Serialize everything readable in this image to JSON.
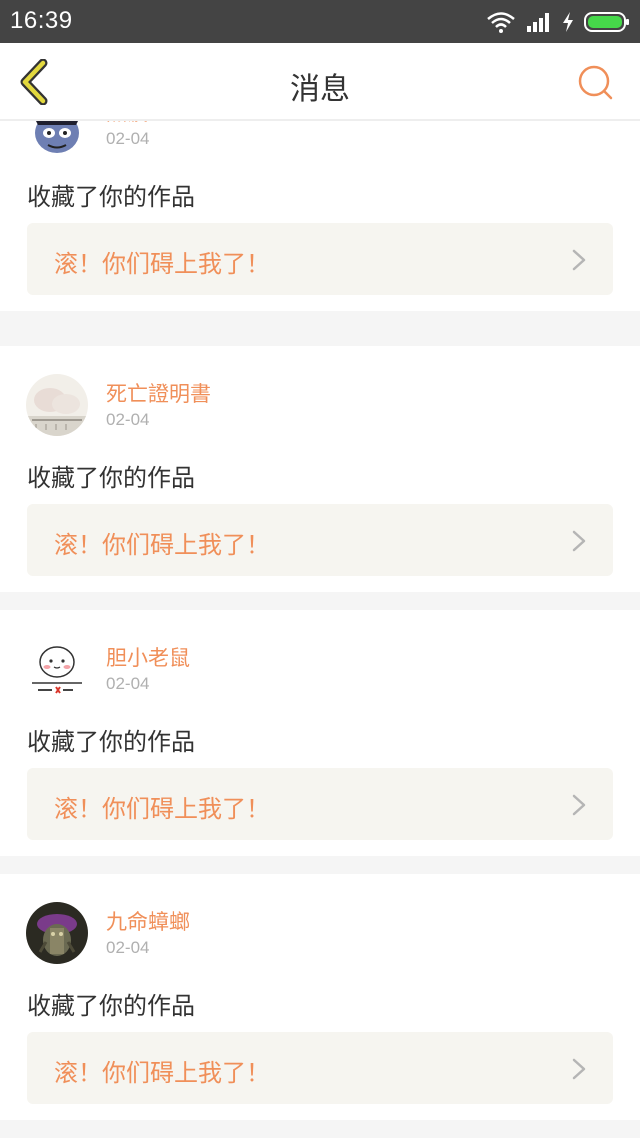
{
  "status_bar": {
    "time": "16:39"
  },
  "header": {
    "title": "消息"
  },
  "colors": {
    "accent": "#f08f59",
    "back_icon": "#d4c93a",
    "work_bg": "#f6f5f0",
    "name": "#f08f59"
  },
  "icons": {
    "back": "chevron-left-icon",
    "search": "search-icon",
    "work_arrow": "chevron-right-icon"
  },
  "messages": [
    {
      "user": "黑波",
      "date": "02-04",
      "action": "收藏了你的作品",
      "work_title": "滚！你们碍上我了！"
    },
    {
      "user": "死亡證明書",
      "date": "02-04",
      "action": "收藏了你的作品",
      "work_title": "滚！你们碍上我了！"
    },
    {
      "user": "胆小老鼠",
      "date": "02-04",
      "action": "收藏了你的作品",
      "work_title": "滚！你们碍上我了！"
    },
    {
      "user": "九命蟑螂",
      "date": "02-04",
      "action": "收藏了你的作品",
      "work_title": "滚！你们碍上我了！"
    }
  ]
}
